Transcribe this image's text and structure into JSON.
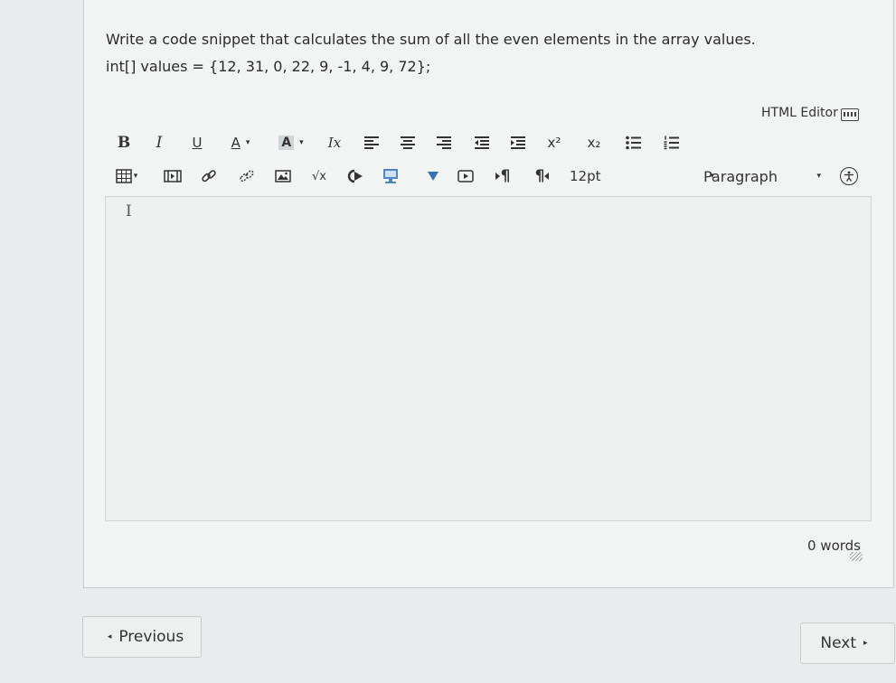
{
  "question": {
    "line1": "Write a code snippet that calculates the sum of all the even elements in the array values.",
    "line2": "int[] values = {12, 31, 0, 22, 9, -1, 4, 9, 72};"
  },
  "editor": {
    "html_editor_label": "HTML Editor",
    "toolbar_row1": {
      "bold": "B",
      "italic": "I",
      "underline": "U",
      "font_color": "A",
      "bg_color": "A",
      "clear_format": "Ix",
      "superscript": "x²",
      "subscript": "x₂"
    },
    "toolbar_row2": {
      "math": "√x",
      "ltr": "¶",
      "rtl": "¶",
      "font_size": "12pt",
      "block_format": "Paragraph"
    },
    "word_count": "0 words"
  },
  "nav": {
    "previous": "Previous",
    "next": "Next"
  },
  "icons": {
    "caret": "▾",
    "prev_arrow": "◂",
    "next_arrow": "▸"
  }
}
